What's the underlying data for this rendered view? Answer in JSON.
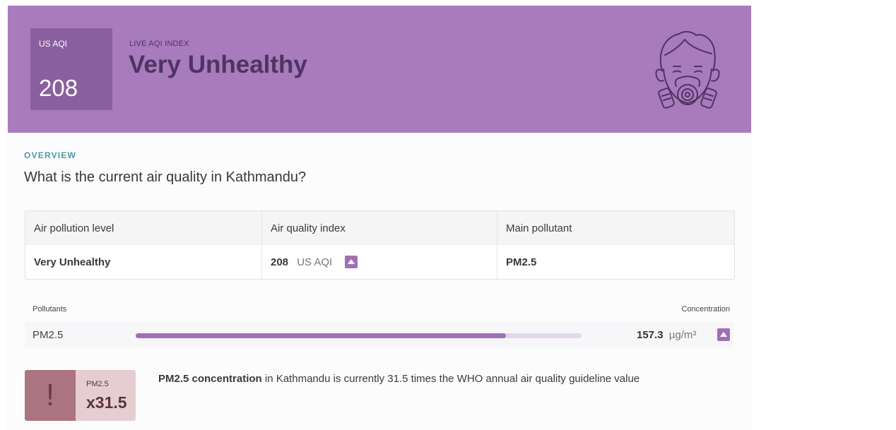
{
  "banner": {
    "aqi_label": "US AQI",
    "aqi_value": "208",
    "live_label": "LIVE AQI INDEX",
    "status": "Very Unhealthy",
    "icon": "gas-mask-icon",
    "bg_color": "#a87bbd"
  },
  "overview": {
    "label": "OVERVIEW",
    "question": "What is the current air quality in Kathmandu?"
  },
  "table": {
    "headers": [
      "Air pollution level",
      "Air quality index",
      "Main pollutant"
    ],
    "level": "Very Unhealthy",
    "aqi_value": "208",
    "aqi_unit": "US AQI",
    "pollutant": "PM2.5"
  },
  "pollutants": {
    "header_left": "Pollutants",
    "header_right": "Concentration",
    "rows": [
      {
        "name": "PM2.5",
        "value": "157.3",
        "unit": "µg/m³",
        "level_fraction": 0.83
      }
    ]
  },
  "who": {
    "icon_glyph": "!",
    "pollutant": "PM2.5",
    "multiplier": "x31.5",
    "text_bold": "PM2.5 concentration",
    "text_rest": " in Kathmandu is currently 31.5 times the WHO annual air quality guideline value"
  },
  "colors": {
    "accent": "#a06fb6",
    "warning": "#ac7381",
    "overview": "#4b99a9"
  }
}
